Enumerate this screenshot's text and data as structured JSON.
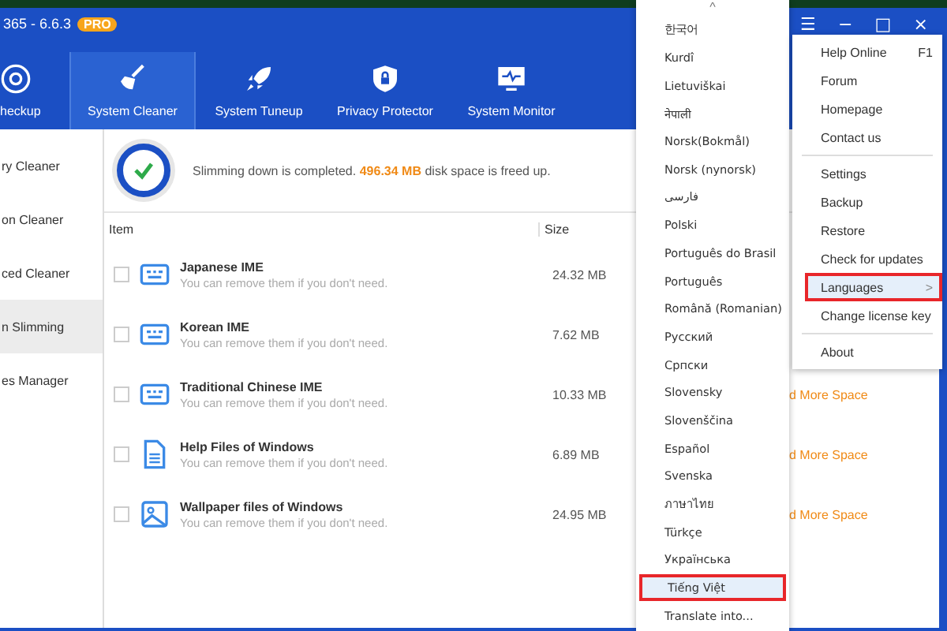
{
  "window": {
    "title": "365 - 6.6.3",
    "badge": "PRO"
  },
  "tabs": [
    {
      "label": "heckup",
      "kind": "scan",
      "selected": false
    },
    {
      "label": "System Cleaner",
      "kind": "broom",
      "selected": true
    },
    {
      "label": "System Tuneup",
      "kind": "rocket",
      "selected": false
    },
    {
      "label": "Privacy Protector",
      "kind": "shield",
      "selected": false
    },
    {
      "label": "System Monitor",
      "kind": "monitor",
      "selected": false
    }
  ],
  "window_controls": [
    "☰",
    "−",
    "□",
    "×"
  ],
  "sidebar": {
    "items": [
      {
        "label": "ry Cleaner",
        "selected": false
      },
      {
        "label": "on Cleaner",
        "selected": false
      },
      {
        "label": "ced Cleaner",
        "selected": false
      },
      {
        "label": "n Slimming",
        "selected": true
      },
      {
        "label": "es Manager",
        "selected": false
      }
    ]
  },
  "banner": {
    "before": "Slimming down is completed.",
    "amount": "496.34 MB",
    "after": "disk space is freed up."
  },
  "table": {
    "columns": [
      "Item",
      "Size"
    ],
    "rows": [
      {
        "kind": "keyboard",
        "title": "Japanese IME",
        "subtitle": "You can remove them if you don't need.",
        "size": "24.32 MB",
        "checked": false
      },
      {
        "kind": "keyboard",
        "title": "Korean IME",
        "subtitle": "You can remove them if you don't need.",
        "size": "7.62 MB",
        "checked": false
      },
      {
        "kind": "keyboard",
        "title": "Traditional Chinese IME",
        "subtitle": "You can remove them if you don't need.",
        "size": "10.33 MB",
        "checked": false,
        "link": "d More Space"
      },
      {
        "kind": "document",
        "title": "Help Files of Windows",
        "subtitle": "You can remove them if you don't need.",
        "size": "6.89 MB",
        "checked": false,
        "link": "d More Space"
      },
      {
        "kind": "image",
        "title": "Wallpaper files of Windows",
        "subtitle": "You can remove them if you don't need.",
        "size": "24.95 MB",
        "checked": false,
        "link": "d More Space"
      }
    ]
  },
  "main_menu": {
    "items": [
      {
        "label": "Help Online",
        "shortcut": "F1",
        "selected": false
      },
      {
        "label": "Forum",
        "selected": false
      },
      {
        "label": "Homepage",
        "selected": false
      },
      {
        "label": "Contact us",
        "selected": false,
        "divider_after": true
      },
      {
        "label": "Settings",
        "selected": false
      },
      {
        "label": "Backup",
        "selected": false
      },
      {
        "label": "Restore",
        "selected": false
      },
      {
        "label": "Check for updates",
        "selected": false
      },
      {
        "label": "Languages",
        "selected": true,
        "submenu_arrow": ">"
      },
      {
        "label": "Change license key",
        "selected": false,
        "divider_after": true
      },
      {
        "label": "About",
        "selected": false
      }
    ]
  },
  "languages_menu": {
    "scroll_up": "^",
    "items": [
      {
        "label": "한국어",
        "selected": false
      },
      {
        "label": "Kurdî",
        "selected": false
      },
      {
        "label": "Lietuviškai",
        "selected": false
      },
      {
        "label": "नेपाली",
        "selected": false
      },
      {
        "label": "Norsk(Bokmål)",
        "selected": false
      },
      {
        "label": "Norsk (nynorsk)",
        "selected": false
      },
      {
        "label": "فارسی",
        "selected": false
      },
      {
        "label": "Polski",
        "selected": false
      },
      {
        "label": "Português do Brasil",
        "selected": false
      },
      {
        "label": "Português",
        "selected": false
      },
      {
        "label": "Română (Romanian)",
        "selected": false
      },
      {
        "label": "Русский",
        "selected": false
      },
      {
        "label": "Српски",
        "selected": false
      },
      {
        "label": "Slovensky",
        "selected": false
      },
      {
        "label": "Slovenščina",
        "selected": false
      },
      {
        "label": "Español",
        "selected": false
      },
      {
        "label": "Svenska",
        "selected": false
      },
      {
        "label": "ภาษาไทย",
        "selected": false
      },
      {
        "label": "Türkçe",
        "selected": false
      },
      {
        "label": "Українська",
        "selected": false
      },
      {
        "label": "Tiếng Việt",
        "selected": true
      },
      {
        "label": "Translate into...",
        "selected": false
      }
    ]
  }
}
